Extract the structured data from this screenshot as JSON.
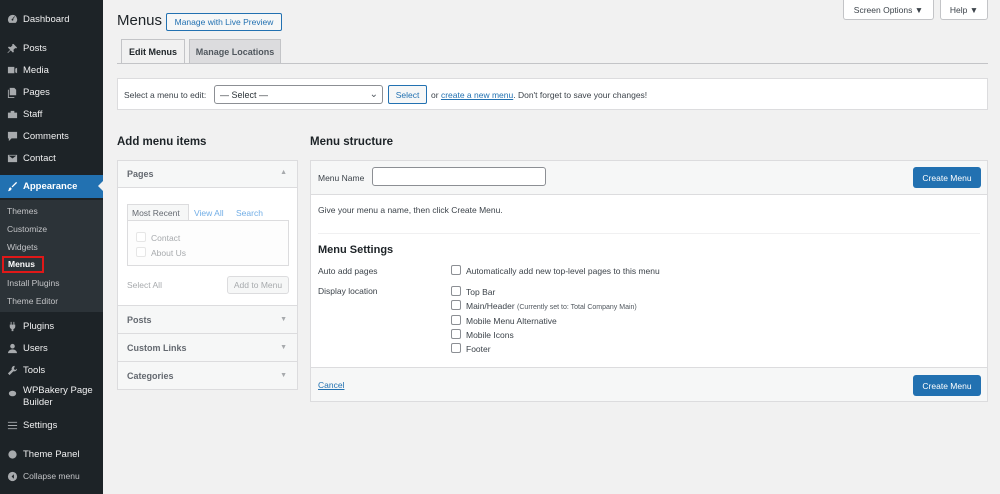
{
  "sidebar": {
    "items": [
      {
        "label": "Dashboard",
        "icon": "dashboard-icon"
      },
      {
        "label": "Posts",
        "icon": "pushpin-icon"
      },
      {
        "label": "Media",
        "icon": "media-icon"
      },
      {
        "label": "Pages",
        "icon": "pages-icon"
      },
      {
        "label": "Staff",
        "icon": "staff-icon"
      },
      {
        "label": "Comments",
        "icon": "comments-icon"
      },
      {
        "label": "Contact",
        "icon": "mail-icon"
      },
      {
        "label": "Appearance",
        "icon": "paintbrush-icon"
      },
      {
        "label": "Plugins",
        "icon": "plugin-icon"
      },
      {
        "label": "Users",
        "icon": "users-icon"
      },
      {
        "label": "Tools",
        "icon": "wrench-icon"
      },
      {
        "label": "WPBakery Page",
        "label2": "Builder",
        "icon": "wpbakery-icon"
      },
      {
        "label": "Settings",
        "icon": "settings-icon"
      },
      {
        "label": "Theme Panel",
        "icon": "theme-panel-icon"
      },
      {
        "label": "Collapse menu",
        "icon": "collapse-icon"
      }
    ],
    "submenu": [
      "Themes",
      "Customize",
      "Widgets",
      "Menus",
      "Install Plugins",
      "Theme Editor"
    ]
  },
  "header": {
    "title": "Menus",
    "live_preview": "Manage with Live Preview",
    "screen_options": "Screen Options",
    "help": "Help"
  },
  "tabs": [
    "Edit Menus",
    "Manage Locations"
  ],
  "selectbar": {
    "label": "Select a menu to edit:",
    "selected": "— Select —",
    "select_btn": "Select",
    "or_text": "or",
    "create_link": "create a new menu",
    "tail": ". Don't forget to save your changes!"
  },
  "add_items": {
    "title": "Add menu items",
    "pages_title": "Pages",
    "subtabs": [
      "Most Recent",
      "View All",
      "Search"
    ],
    "pages": [
      "Contact",
      "About Us"
    ],
    "select_all": "Select All",
    "add_btn": "Add to Menu",
    "sections": [
      "Posts",
      "Custom Links",
      "Categories"
    ]
  },
  "structure": {
    "title": "Menu structure",
    "name_label": "Menu Name",
    "name_value": "",
    "create_btn": "Create Menu",
    "hint": "Give your menu a name, then click Create Menu.",
    "settings_title": "Menu Settings",
    "auto_label": "Auto add pages",
    "auto_option": "Automatically add new top-level pages to this menu",
    "display_label": "Display location",
    "locations": [
      {
        "label": "Top Bar",
        "note": ""
      },
      {
        "label": "Main/Header",
        "note": "(Currently set to: Total Company Main)"
      },
      {
        "label": "Mobile Menu Alternative",
        "note": ""
      },
      {
        "label": "Mobile Icons",
        "note": ""
      },
      {
        "label": "Footer",
        "note": ""
      }
    ],
    "cancel": "Cancel"
  },
  "colors": {
    "accent": "#2271b1",
    "sidebar": "#1d2327",
    "highlight": "#e01818"
  }
}
